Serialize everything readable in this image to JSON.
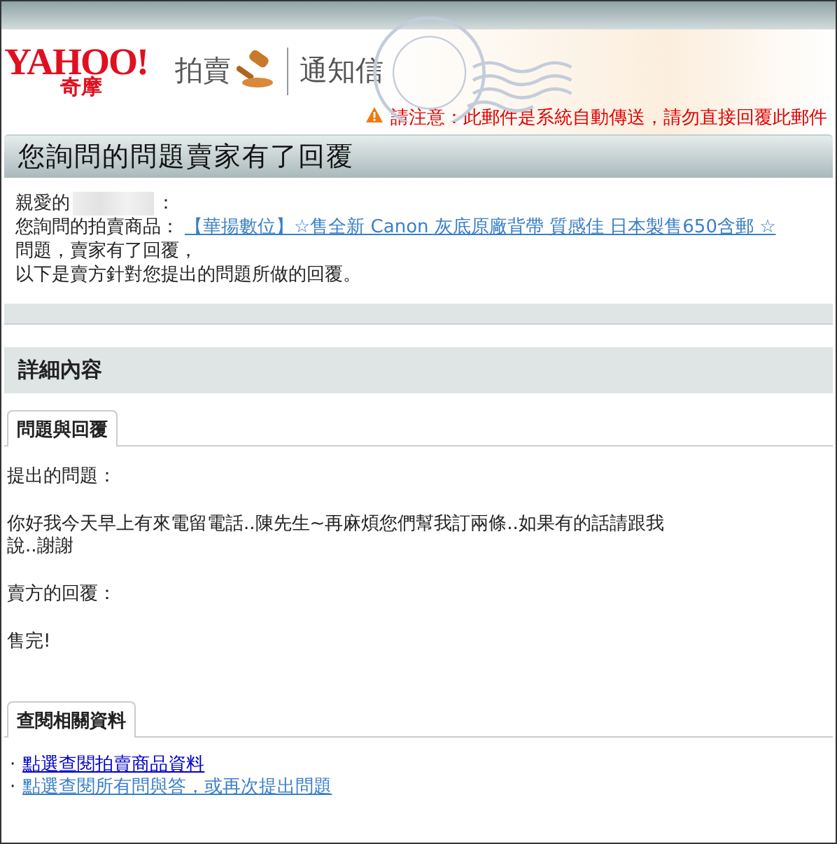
{
  "header": {
    "logo_text": "YAHOO!",
    "logo_subtext": "奇摩",
    "service": "拍賣",
    "title": "通知信",
    "notice": "請注意：此郵件是系統自動傳送，請勿直接回覆此郵件"
  },
  "headline": "您詢問的問題賣家有了回覆",
  "greeting": {
    "salutation": "親愛的",
    "colon": "：",
    "intro": "您詢問的拍賣商品：",
    "item_link": "【華揚數位】☆售全新 Canon 灰底原廠背帶 質感佳 日本製售650含郵 ☆",
    "intro_end": "問題，賣家有了回覆，",
    "closing": "以下是賣方針對您提出的問題所做的回覆。"
  },
  "details": {
    "title": "詳細內容",
    "qa_tab": "問題與回覆",
    "question_label": "提出的問題：",
    "question": "你好我今天早上有來電留電話..陳先生~再麻煩您們幫我訂兩條..如果有的話請跟我說..謝謝",
    "answer_label": "賣方的回覆：",
    "answer": "售完!"
  },
  "related": {
    "tab": "查閱相關資料",
    "links": [
      {
        "bullet": "·",
        "text": "點選查閱拍賣商品資料",
        "visited": false
      },
      {
        "bullet": "·",
        "text": "點選查閱所有問與答，或再次提出問題",
        "visited": true
      }
    ]
  }
}
